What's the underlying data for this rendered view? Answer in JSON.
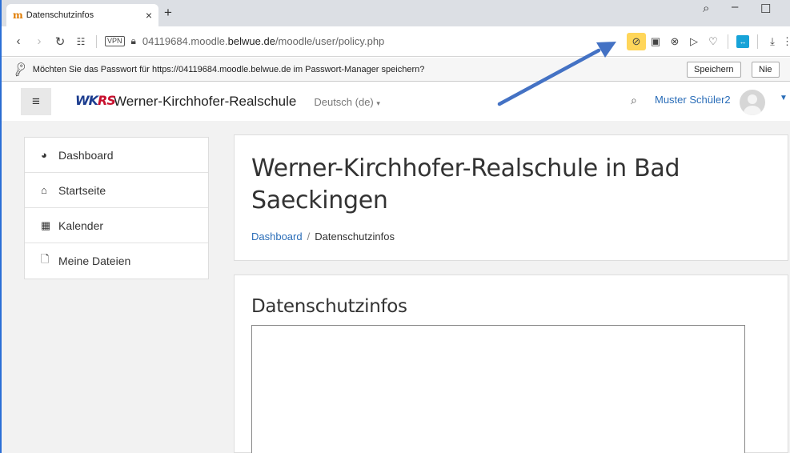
{
  "browser": {
    "tab_title": "Datenschutzinfos",
    "tab_favicon": "m",
    "tab_close": "×",
    "new_tab": "+",
    "window_controls": [
      "search-icon",
      "minimize-icon",
      "maximize-icon"
    ],
    "vpn_label": "VPN",
    "url_prefix": "04119684.moodle.",
    "url_domain": "belwue.de",
    "url_path": "/moodle/user/policy.php",
    "accent_color": "#2b6fd6",
    "highlight_color": "#ffd65a"
  },
  "password_bar": {
    "message": "Möchten Sie das Passwort für https://04119684.moodle.belwue.de im Passwort-Manager speichern?",
    "save_label": "Speichern",
    "never_label": "Nie"
  },
  "moodle_nav": {
    "site_name": "Werner-Kirchhofer-Realschule",
    "logo_text": "WKRS",
    "language": "Deutsch (de)",
    "user_name": "Muster Schüler2"
  },
  "sidebar": {
    "items": [
      {
        "label": "Dashboard",
        "icon": "dashboard-icon"
      },
      {
        "label": "Startseite",
        "icon": "home-icon"
      },
      {
        "label": "Kalender",
        "icon": "calendar-icon"
      },
      {
        "label": "Meine Dateien",
        "icon": "file-icon"
      }
    ]
  },
  "header": {
    "title": "Werner-Kirchhofer-Realschule in Bad Saeckingen",
    "breadcrumb": [
      "Dashboard",
      "Datenschutzinfos"
    ]
  },
  "main": {
    "heading": "Datenschutzinfos"
  }
}
